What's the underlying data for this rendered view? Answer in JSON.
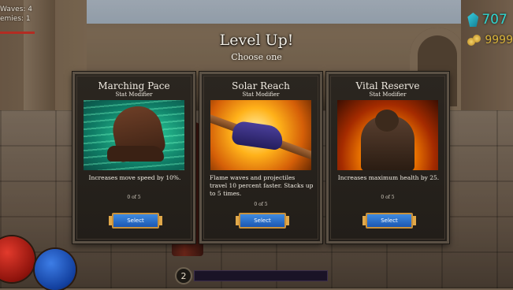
{
  "hud": {
    "waves_label": "Waves: 4",
    "enemies_label": "emies: 1",
    "gems": "707",
    "gold": "9999",
    "player_level": "2",
    "xp_progress": 0.0
  },
  "level_up": {
    "title": "Level Up!",
    "subtitle": "Choose one"
  },
  "cards": [
    {
      "name": "Marching Pace",
      "type": "Stat Modifier",
      "description": "Increases move speed by 10%.",
      "count": "0 of 5",
      "button": "Select"
    },
    {
      "name": "Solar Reach",
      "type": "Stat Modifier",
      "description": "Flame waves and projectiles travel 10 percent faster. Stacks up to 5 times.",
      "count": "0 of 5",
      "button": "Select"
    },
    {
      "name": "Vital Reserve",
      "type": "Stat Modifier",
      "description": "Increases maximum health by 25.",
      "count": "0 of 5",
      "button": "Select"
    }
  ]
}
